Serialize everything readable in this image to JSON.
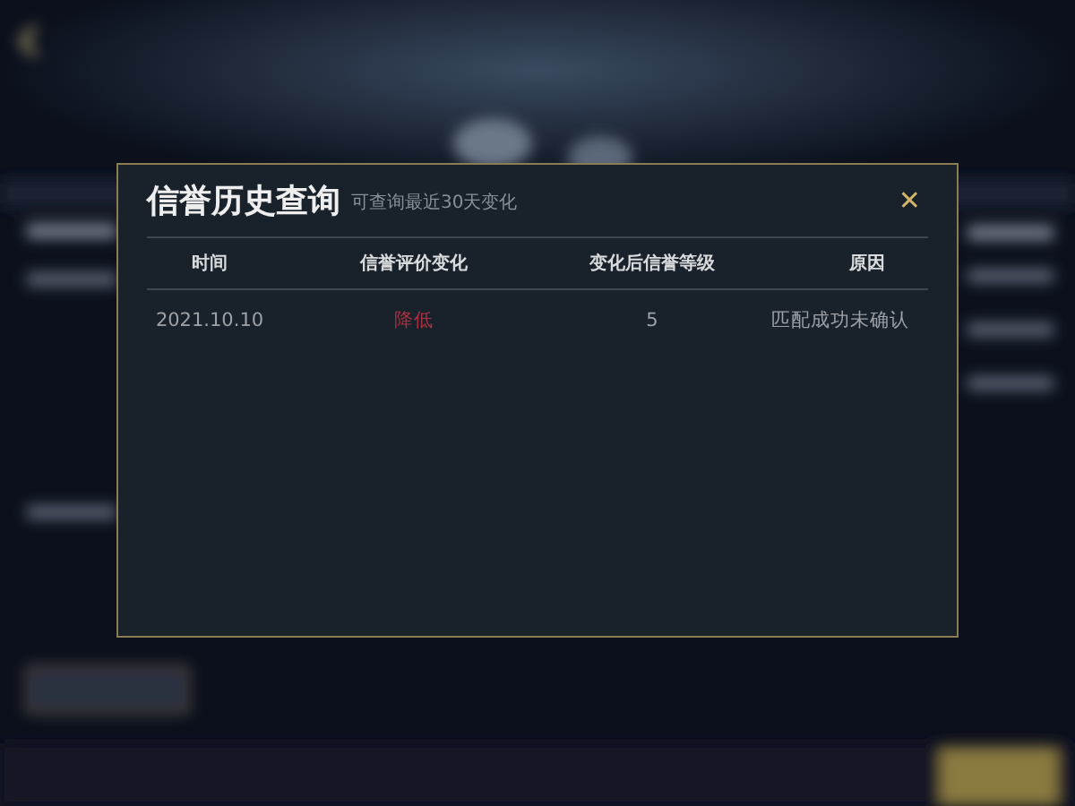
{
  "dialog": {
    "title": "信誉历史查询",
    "subtitle": "可查询最近30天变化",
    "close": "✕"
  },
  "table": {
    "columns": [
      "时间",
      "信誉评价变化",
      "变化后信誉等级",
      "原因"
    ],
    "rows": [
      {
        "time": "2021.10.10",
        "change": "降低",
        "color": "#a8323f",
        "level": "5",
        "reason": "匹配成功未确认"
      }
    ]
  }
}
